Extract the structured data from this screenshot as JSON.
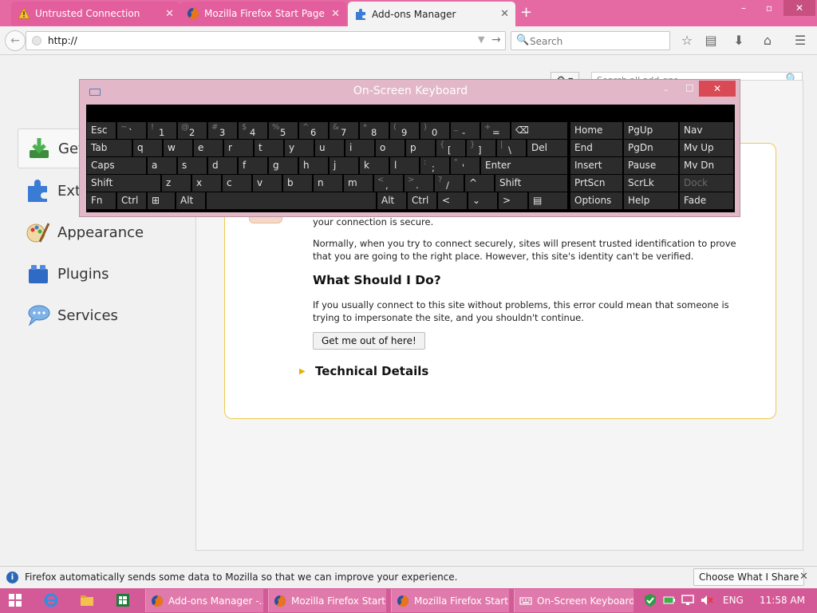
{
  "tabs": [
    {
      "label": "Untrusted Connection",
      "icon": "warning-icon",
      "active": false
    },
    {
      "label": "Mozilla Firefox Start Page",
      "icon": "firefox-icon",
      "active": false
    },
    {
      "label": "Add-ons Manager",
      "icon": "puzzle-icon",
      "active": true
    }
  ],
  "tab_close": "✕",
  "new_tab": "+",
  "window_controls": {
    "minimize": "–",
    "maximize": "▫",
    "close": "✕"
  },
  "navbar": {
    "back": "←",
    "url": "http://",
    "url_dropdown": "▼",
    "url_go": "→",
    "search_placeholder": "Search",
    "search_icon": "🔍",
    "bookmark_icon": "☆",
    "library_icon": "▤",
    "download_icon": "⬇",
    "home_icon": "⌂",
    "menu_icon": "☰"
  },
  "addons": {
    "search_placeholder": "Search all add-ons",
    "search_icon": "🔍",
    "gear": "⚙ ▾",
    "categories": [
      {
        "label": "Get Add-ons",
        "icon": "download-icon",
        "selected": true
      },
      {
        "label": "Extensions",
        "icon": "puzzle-icon",
        "selected": false
      },
      {
        "label": "Appearance",
        "icon": "paintbrush-icon",
        "selected": false
      },
      {
        "label": "Plugins",
        "icon": "lego-icon",
        "selected": false
      },
      {
        "label": "Services",
        "icon": "chat-icon",
        "selected": false
      }
    ]
  },
  "error": {
    "line1": "your connection is secure.",
    "para1": "Normally, when you try to connect securely, sites will present trusted identification to prove that you are going to the right place. However, this site's identity can't be verified.",
    "heading": "What Should I Do?",
    "para2": "If you usually connect to this site without problems, this error could mean that someone is trying to impersonate the site, and you shouldn't continue.",
    "button": "Get me out of here!",
    "tech_arrow": "▶",
    "tech_heading": "Technical Details"
  },
  "osk": {
    "title": "On-Screen Keyboard",
    "minimize": "–",
    "maximize": "□",
    "close": "✕",
    "row1": [
      {
        "main": "Esc"
      },
      {
        "sup": "~",
        "main": "`"
      },
      {
        "sup": "!",
        "main": "1"
      },
      {
        "sup": "@",
        "main": "2"
      },
      {
        "sup": "#",
        "main": "3"
      },
      {
        "sup": "$",
        "main": "4"
      },
      {
        "sup": "%",
        "main": "5"
      },
      {
        "sup": "^",
        "main": "6"
      },
      {
        "sup": "&",
        "main": "7"
      },
      {
        "sup": "*",
        "main": "8"
      },
      {
        "sup": "(",
        "main": "9"
      },
      {
        "sup": ")",
        "main": "0"
      },
      {
        "sup": "_",
        "main": "-"
      },
      {
        "sup": "+",
        "main": "="
      },
      {
        "main": "⌫"
      }
    ],
    "row2": [
      {
        "main": "Tab"
      },
      {
        "main": "q"
      },
      {
        "main": "w"
      },
      {
        "main": "e"
      },
      {
        "main": "r"
      },
      {
        "main": "t"
      },
      {
        "main": "y"
      },
      {
        "main": "u"
      },
      {
        "main": "i"
      },
      {
        "main": "o"
      },
      {
        "main": "p"
      },
      {
        "sup": "{",
        "main": "["
      },
      {
        "sup": "}",
        "main": "]"
      },
      {
        "sup": "|",
        "main": "\\"
      },
      {
        "main": "Del"
      }
    ],
    "row3": [
      {
        "main": "Caps"
      },
      {
        "main": "a"
      },
      {
        "main": "s"
      },
      {
        "main": "d"
      },
      {
        "main": "f"
      },
      {
        "main": "g"
      },
      {
        "main": "h"
      },
      {
        "main": "j"
      },
      {
        "main": "k"
      },
      {
        "main": "l"
      },
      {
        "sup": ":",
        "main": ";"
      },
      {
        "sup": "\"",
        "main": "'"
      },
      {
        "main": "Enter"
      }
    ],
    "row4": [
      {
        "main": "Shift"
      },
      {
        "main": "z"
      },
      {
        "main": "x"
      },
      {
        "main": "c"
      },
      {
        "main": "v"
      },
      {
        "main": "b"
      },
      {
        "main": "n"
      },
      {
        "main": "m"
      },
      {
        "sup": "<",
        "main": ","
      },
      {
        "sup": ">",
        "main": "."
      },
      {
        "sup": "?",
        "main": "/"
      },
      {
        "main": "^"
      },
      {
        "main": "Shift"
      }
    ],
    "row5": [
      {
        "main": "Fn"
      },
      {
        "main": "Ctrl"
      },
      {
        "main": "⊞"
      },
      {
        "main": "Alt"
      },
      {
        "main": ""
      },
      {
        "main": "Alt"
      },
      {
        "main": "Ctrl"
      },
      {
        "main": "<"
      },
      {
        "main": "⌄"
      },
      {
        "main": ">"
      },
      {
        "main": "▤"
      }
    ],
    "nav_keys": [
      [
        "Home",
        "PgUp",
        "Nav"
      ],
      [
        "End",
        "PgDn",
        "Mv Up"
      ],
      [
        "Insert",
        "Pause",
        "Mv Dn"
      ],
      [
        "PrtScn",
        "ScrLk",
        "Dock"
      ],
      [
        "Options",
        "Help",
        "Fade"
      ]
    ]
  },
  "notification": {
    "icon": "i",
    "text": "Firefox automatically sends some data to Mozilla so that we can improve your experience.",
    "button": "Choose What I Share",
    "close": "✕"
  },
  "taskbar": {
    "tasks": [
      {
        "label": "Add-ons Manager -...",
        "icon": "firefox-icon"
      },
      {
        "label": "Mozilla Firefox Start...",
        "icon": "firefox-icon"
      },
      {
        "label": "Mozilla Firefox Start...",
        "icon": "firefox-icon"
      },
      {
        "label": "On-Screen Keyboard",
        "icon": "keyboard-icon"
      }
    ],
    "language": "ENG",
    "time": "11:58 AM"
  },
  "colors": {
    "titlebar": "#e56aa3",
    "taskbar": "#d45a97",
    "error_border": "#f0c94f",
    "osk_frame": "#e2b7c7"
  }
}
